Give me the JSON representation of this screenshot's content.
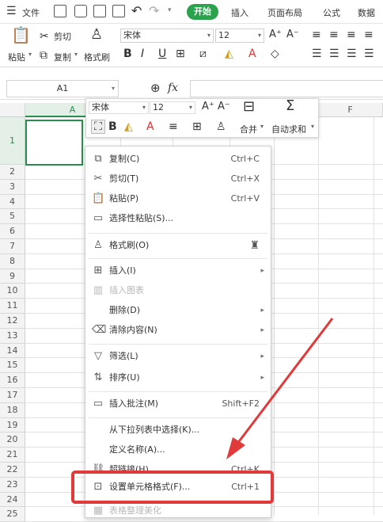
{
  "menubar": {
    "file": "文件",
    "tabs": [
      "开始",
      "插入",
      "页面布局",
      "公式",
      "数据"
    ]
  },
  "ribbon": {
    "paste": "粘贴",
    "cut": "剪切",
    "copy": "复制",
    "format_painter": "格式刷",
    "font_name": "宋体",
    "font_size": "12"
  },
  "formula_bar": {
    "name_box": "A1",
    "fx": "fx"
  },
  "grid": {
    "columns": [
      "A",
      "F"
    ],
    "rows": [
      "1",
      "2",
      "3",
      "4",
      "5",
      "6",
      "7",
      "8",
      "9",
      "10",
      "11",
      "12",
      "13",
      "14",
      "15",
      "16",
      "17",
      "18",
      "19",
      "20",
      "21",
      "22",
      "23",
      "24",
      "25"
    ]
  },
  "mini_toolbar": {
    "font_name": "宋体",
    "font_size": "12",
    "merge": "合并",
    "autosum": "自动求和"
  },
  "context_menu": {
    "items": [
      {
        "label": "复制(C)",
        "shortcut": "Ctrl+C"
      },
      {
        "label": "剪切(T)",
        "shortcut": "Ctrl+X"
      },
      {
        "label": "粘贴(P)",
        "shortcut": "Ctrl+V"
      },
      {
        "label": "选择性粘贴(S)...",
        "shortcut": ""
      },
      {
        "label": "格式刷(O)",
        "shortcut": ""
      },
      {
        "label": "插入(I)",
        "shortcut": ""
      },
      {
        "label": "插入图表",
        "shortcut": ""
      },
      {
        "label": "删除(D)",
        "shortcut": ""
      },
      {
        "label": "清除内容(N)",
        "shortcut": ""
      },
      {
        "label": "筛选(L)",
        "shortcut": ""
      },
      {
        "label": "排序(U)",
        "shortcut": ""
      },
      {
        "label": "插入批注(M)",
        "shortcut": "Shift+F2"
      },
      {
        "label": "从下拉列表中选择(K)...",
        "shortcut": ""
      },
      {
        "label": "定义名称(A)...",
        "shortcut": ""
      },
      {
        "label": "超链接(H)...",
        "shortcut": "Ctrl+K"
      },
      {
        "label": "设置单元格格式(F)...",
        "shortcut": "Ctrl+1"
      },
      {
        "label": "表格整理美化",
        "shortcut": ""
      }
    ]
  },
  "colors": {
    "accent_green": "#2ba24c",
    "annotation_red": "#e03a3a"
  }
}
